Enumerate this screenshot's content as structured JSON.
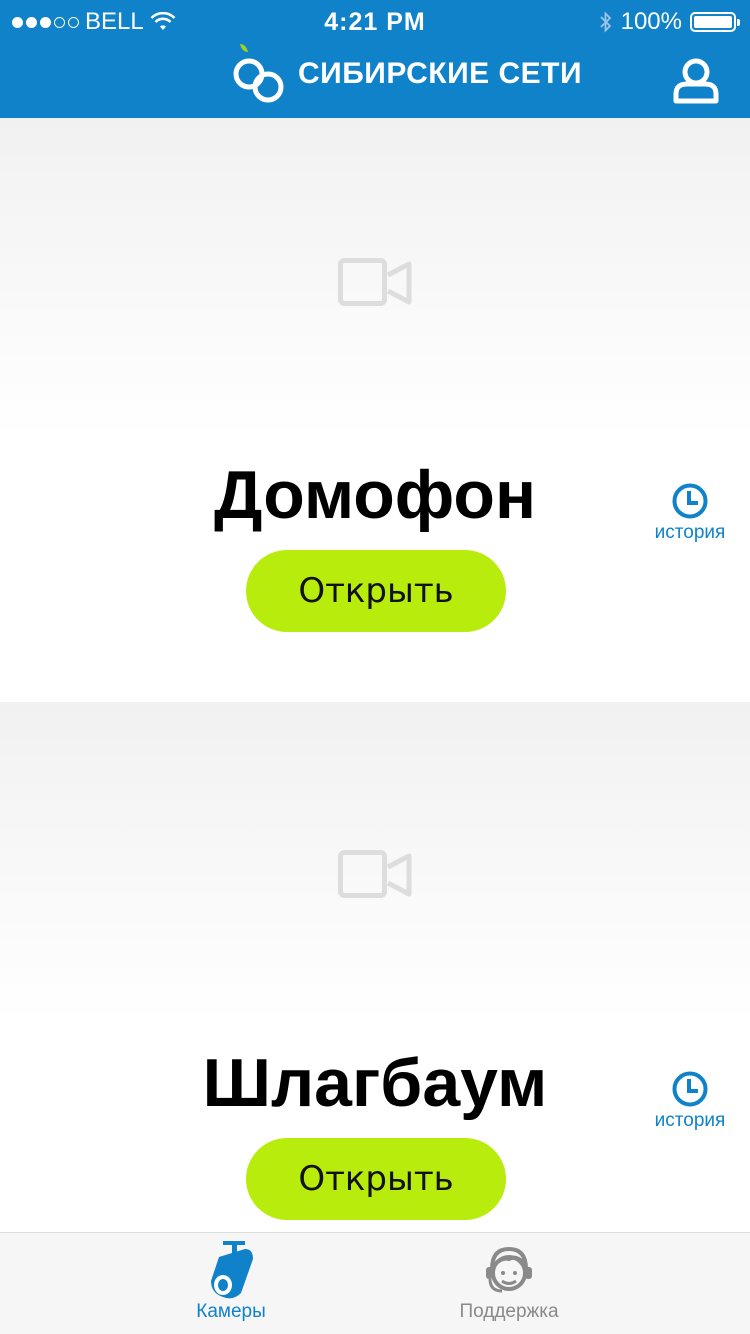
{
  "status_bar": {
    "carrier": "BELL",
    "time": "4:21 PM",
    "battery": "100%",
    "signal_bars": 3
  },
  "header": {
    "brand": "СИБИРСКИЕ СЕТИ",
    "profile_icon": "user-icon"
  },
  "doors": [
    {
      "name": "Домофон",
      "open_label": "Открыть",
      "history_label": "история",
      "preview_icon": "video-camera-icon"
    },
    {
      "name": "Шлагбаум",
      "open_label": "Открыть",
      "history_label": "история",
      "preview_icon": "video-camera-icon"
    }
  ],
  "tabbar": {
    "tabs": [
      {
        "label": "Камеры",
        "icon": "camera-icon",
        "active": true
      },
      {
        "label": "Поддержка",
        "icon": "support-icon",
        "active": false
      }
    ]
  },
  "colors": {
    "header_bg": "#0f82c9",
    "button_bg": "#b8ec0c",
    "accent": "#0f82c9",
    "logo_leaf": "#9fd121"
  }
}
